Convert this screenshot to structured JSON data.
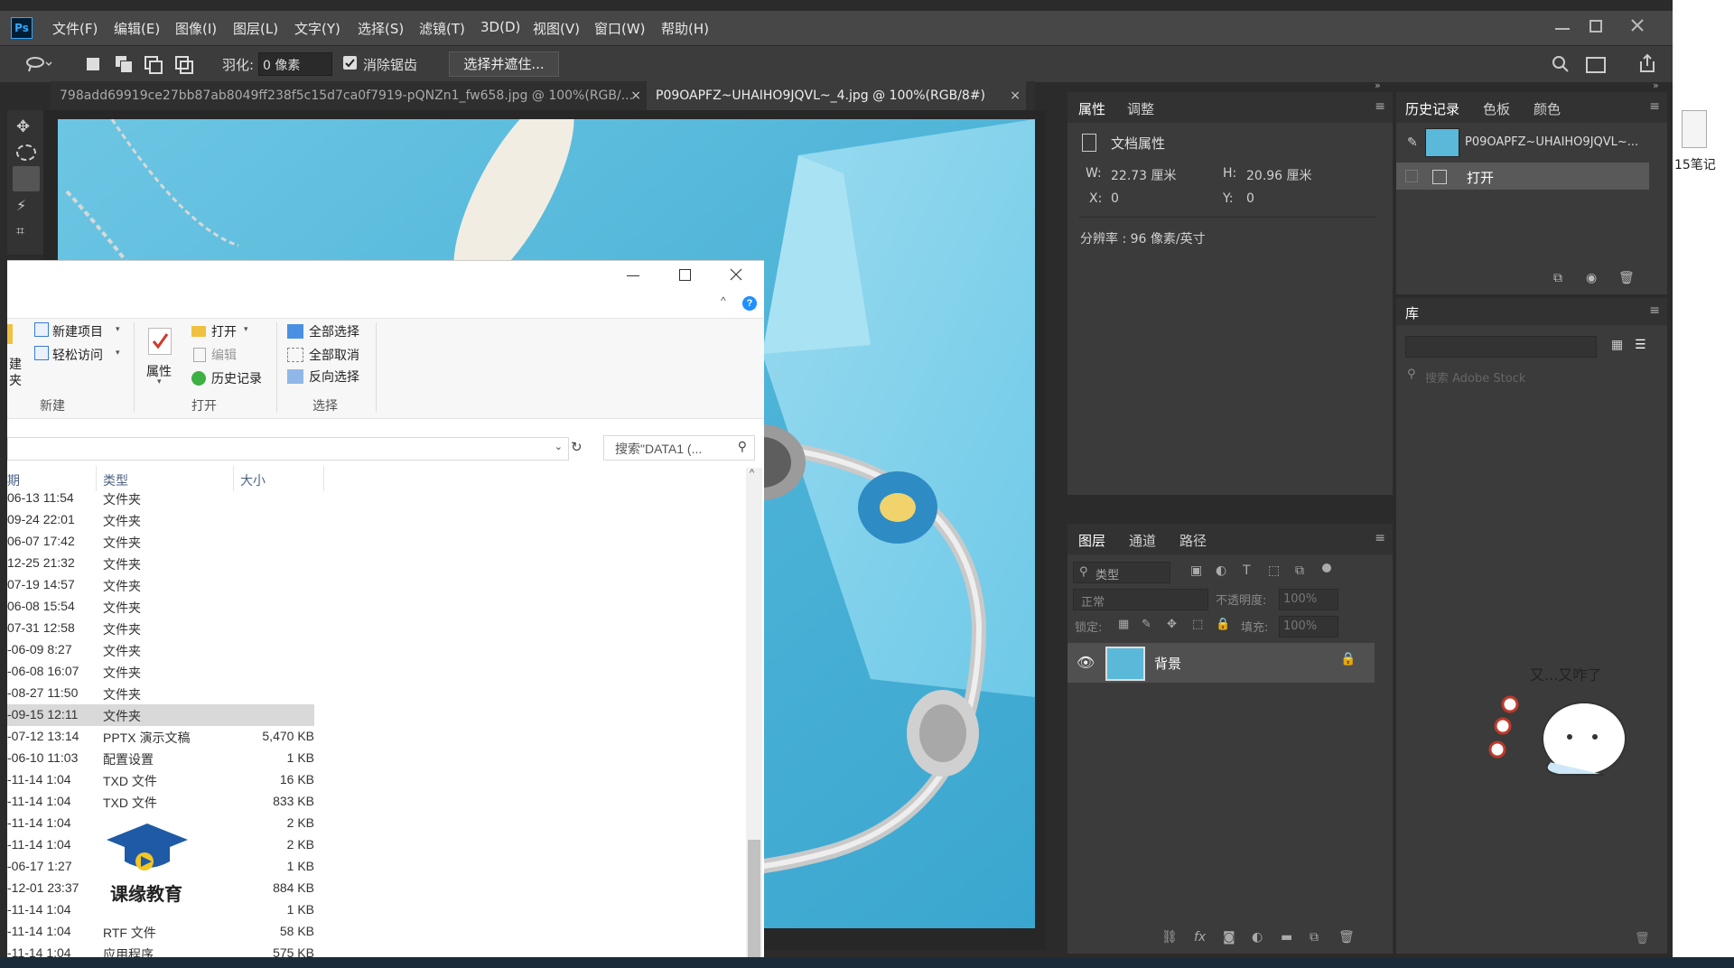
{
  "app": {
    "logo_text": "Ps",
    "menu": [
      "文件(F)",
      "编辑(E)",
      "图像(I)",
      "图层(L)",
      "文字(Y)",
      "选择(S)",
      "滤镜(T)",
      "3D(D)",
      "视图(V)",
      "窗口(W)",
      "帮助(H)"
    ]
  },
  "options": {
    "feather_label": "羽化:",
    "feather_value": "0 像素",
    "antialias_label": "消除锯齿",
    "antialias_checked": true,
    "select_mask_button": "选择并遮住..."
  },
  "tabs": [
    {
      "label": "798add69919ce27bb87ab8049ff238f5c15d7ca0f7919-pQNZn1_fw658.jpg @ 100%(RGB/...",
      "active": false
    },
    {
      "label": "P09OAPFZ~UHAIHO9JQVL~_4.jpg @ 100%(RGB/8#)",
      "active": true
    }
  ],
  "properties_panel": {
    "tabs": [
      "属性",
      "调整"
    ],
    "section_title": "文档属性",
    "w_label": "W:",
    "w_value": "22.73 厘米",
    "h_label": "H:",
    "h_value": "20.96 厘米",
    "x_label": "X:",
    "x_value": "0",
    "y_label": "Y:",
    "y_value": "0",
    "resolution": "分辨率 : 96 像素/英寸"
  },
  "history_panel": {
    "tabs": [
      "历史记录",
      "色板",
      "颜色"
    ],
    "snapshot_label": "P09OAPFZ~UHAIHO9JQVL~...",
    "items": [
      "打开"
    ]
  },
  "library_panel": {
    "title": "库",
    "search_placeholder": "搜索 Adobe Stock"
  },
  "layers_panel": {
    "tabs": [
      "图层",
      "通道",
      "路径"
    ],
    "filter_label": "类型",
    "blend_mode": "正常",
    "opacity_label": "不透明度:",
    "opacity_value": "100%",
    "lock_label": "锁定:",
    "fill_label": "填充:",
    "fill_value": "100%",
    "layers": [
      {
        "name": "背景",
        "visible": true,
        "locked": true
      }
    ]
  },
  "explorer": {
    "ribbon": {
      "new_item": "新建项目",
      "easy_access": "轻松访问",
      "new_folder_partial_1": "建",
      "new_folder_partial_2": "夹",
      "properties": "属性",
      "open": "打开",
      "edit": "编辑",
      "history": "历史记录",
      "select_all": "全部选择",
      "select_none": "全部取消",
      "invert_selection": "反向选择",
      "group_new": "新建",
      "group_open": "打开",
      "group_select": "选择"
    },
    "search_placeholder": "搜索\"DATA1 (...",
    "columns": {
      "date": "期",
      "type": "类型",
      "size": "大小"
    },
    "rows": [
      {
        "date": "06-13 11:54",
        "type": "文件夹",
        "size": ""
      },
      {
        "date": "09-24 22:01",
        "type": "文件夹",
        "size": ""
      },
      {
        "date": "06-07 17:42",
        "type": "文件夹",
        "size": ""
      },
      {
        "date": "12-25 21:32",
        "type": "文件夹",
        "size": ""
      },
      {
        "date": "07-19 14:57",
        "type": "文件夹",
        "size": ""
      },
      {
        "date": "06-08 15:54",
        "type": "文件夹",
        "size": ""
      },
      {
        "date": "07-31 12:58",
        "type": "文件夹",
        "size": ""
      },
      {
        "date": "-06-09 8:27",
        "type": "文件夹",
        "size": ""
      },
      {
        "date": "-06-08 16:07",
        "type": "文件夹",
        "size": ""
      },
      {
        "date": "-08-27 11:50",
        "type": "文件夹",
        "size": ""
      },
      {
        "date": "-09-15 12:11",
        "type": "文件夹",
        "size": "",
        "selected": true
      },
      {
        "date": "-07-12 13:14",
        "type": "PPTX 演示文稿",
        "size": "5,470 KB"
      },
      {
        "date": "-06-10 11:03",
        "type": "配置设置",
        "size": "1 KB"
      },
      {
        "date": "-11-14 1:04",
        "type": "TXD 文件",
        "size": "16 KB"
      },
      {
        "date": "-11-14 1:04",
        "type": "TXD 文件",
        "size": "833 KB"
      },
      {
        "date": "-11-14 1:04",
        "type": "",
        "size": "2 KB"
      },
      {
        "date": "-11-14 1:04",
        "type": "",
        "size": "2 KB"
      },
      {
        "date": "-06-17 1:27",
        "type": "",
        "size": "1 KB"
      },
      {
        "date": "-12-01 23:37",
        "type": "",
        "size": "884 KB"
      },
      {
        "date": "-11-14 1:04",
        "type": "",
        "size": "1 KB"
      },
      {
        "date": "-11-14 1:04",
        "type": "RTF 文件",
        "size": "58 KB"
      },
      {
        "date": "-11-14 1:04",
        "type": "应用程序",
        "size": "575 KB"
      }
    ],
    "watermark_text": "课缘教育"
  },
  "desktop": {
    "notes_label": "15笔记",
    "sticker_text": "又...又咋了"
  },
  "colors": {
    "ps_dark": "#2b2b2b",
    "ps_panel": "#3b3b3b",
    "ps_menu": "#474747",
    "photo_bg": "#5ab8d9",
    "accent_blue": "#1e90ff"
  }
}
